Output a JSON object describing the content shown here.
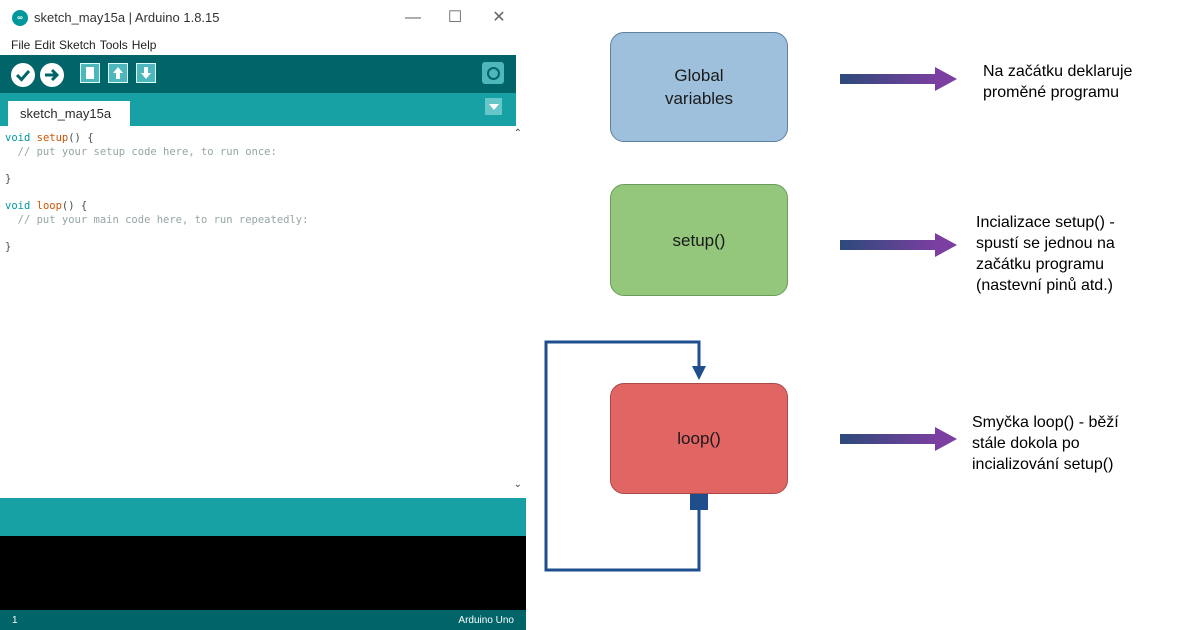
{
  "window": {
    "title": "sketch_may15a | Arduino 1.8.15",
    "logo_text": "∞",
    "controls": {
      "minimize": "—",
      "maximize": "☐",
      "close": "✕"
    }
  },
  "menu": [
    "File",
    "Edit",
    "Sketch",
    "Tools",
    "Help"
  ],
  "toolbar": {
    "buttons": [
      "verify-icon",
      "upload-icon",
      "new-icon",
      "open-icon",
      "save-icon",
      "serial-monitor-icon"
    ]
  },
  "tab": {
    "name": "sketch_may15a"
  },
  "code_lines": [
    "void setup() {",
    "  // put your setup code here, to run once:",
    "",
    "}",
    "",
    "void loop() {",
    "  // put your main code here, to run repeatedly:",
    "",
    "}"
  ],
  "status": {
    "line": "1",
    "board": "Arduino Uno"
  },
  "colors": {
    "teal_dark": "#006468",
    "teal": "#17a1a5",
    "global_box": "#9fc0dc",
    "setup_box": "#94c67c",
    "loop_box": "#e06563",
    "arrow": "#5b3a8a",
    "loop_line": "#1f4e8c"
  },
  "diagram": {
    "boxes": {
      "global": "Global\nvariables",
      "setup": "setup()",
      "loop": "loop()"
    },
    "descriptions": {
      "global": "Na začátku deklaruje\nproměné programu",
      "setup": "Incializace setup() -\nspustí se jednou na\nzačátku programu\n(nastevní pinů atd.)",
      "loop": "Smyčka loop() - běží\nstále dokola po\nincializování setup()"
    }
  }
}
